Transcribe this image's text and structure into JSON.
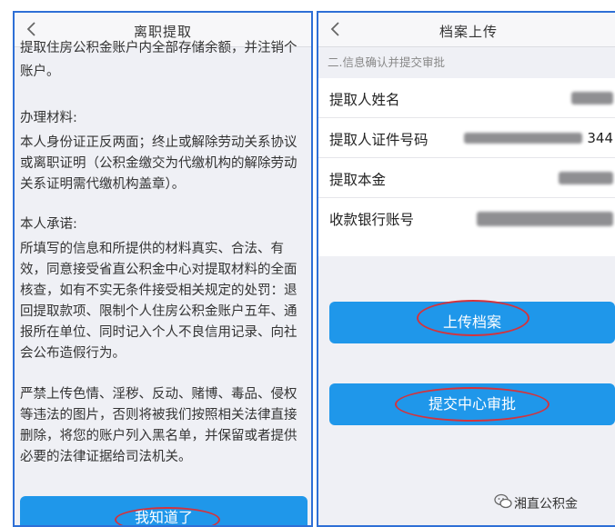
{
  "left_panel": {
    "nav_title": "离职提取",
    "cut_text": "提取住房公积金账户内全部存储余额，并注销个人",
    "para_account": "账户。",
    "materials_heading": "办理材料:",
    "materials_body": "本人身份证正反两面；终止或解除劳动关系协议或离职证明（公积金缴交为代缴机构的解除劳动关系证明需代缴机构盖章）。",
    "promise_heading": "本人承诺:",
    "promise_body": "所填写的信息和所提供的材料真实、合法、有效，同意接受省直公积金中心对提取材料的全面核查，如有不实无条件接受相关规定的处罚：退回提取款项、限制个人住房公积金账户五年、通报所在单位、同时记入个人不良信用记录、向社会公布造假行为。",
    "prohibit_body": "严禁上传色情、淫秽、反动、赌博、毒品、侵权等违法的图片，否则将被我们按照相关法律直接删除，将您的账户列入黑名单，并保留或者提供必要的法律证据给司法机关。",
    "ok_button": "我知道了"
  },
  "right_panel": {
    "nav_title": "档案上传",
    "section_head": "二.信息确认并提交审批",
    "rows": [
      {
        "label": "提取人姓名",
        "value": ""
      },
      {
        "label": "提取人证件号码",
        "value": "344"
      },
      {
        "label": "提取本金",
        "value": ""
      },
      {
        "label": "收款银行账号",
        "value": ""
      }
    ],
    "upload_button": "上传档案",
    "submit_button": "提交中心审批"
  },
  "watermark": "湘直公积金",
  "colors": {
    "accent": "#1f97ea",
    "highlight": "#d4333c",
    "border": "#2e6fd6"
  }
}
